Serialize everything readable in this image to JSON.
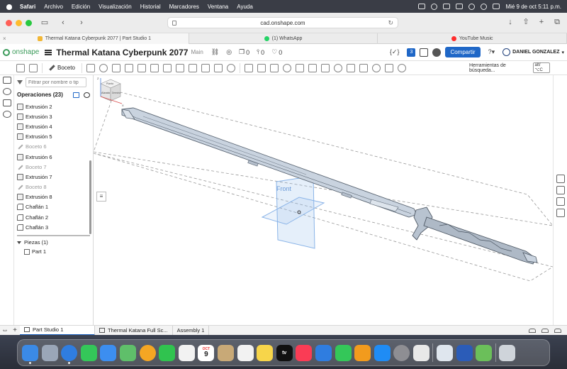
{
  "menubar": {
    "app": "Safari",
    "items": [
      "Archivo",
      "Edición",
      "Visualización",
      "Historial",
      "Marcadores",
      "Ventana",
      "Ayuda"
    ],
    "clock": "Mié 9 de oct  5:11 p.m."
  },
  "browser": {
    "url": "cad.onshape.com",
    "tabs": [
      {
        "title": "Thermal Katana Cyberpunk 2077 | Part Studio 1",
        "color": "#f2b736"
      },
      {
        "title": "(1) WhatsApp",
        "color": "#25d366"
      },
      {
        "title": "YouTube Music",
        "color": "#ff2d2d"
      }
    ]
  },
  "onshape": {
    "logo": "onshape",
    "doc_title": "Thermal Katana Cyberpunk 2077",
    "branch": "Main",
    "counters": {
      "a": "0",
      "b": "0",
      "c": "0"
    },
    "notif_count": "3",
    "share_label": "Compartir",
    "user": "DANIEL GONZALEZ",
    "brace_icon": "{✓}"
  },
  "toolbar": {
    "sketch_label": "Boceto",
    "search_placeholder": "Herramientas de búsqueda...",
    "search_shortcut": "alt/⌥C"
  },
  "features": {
    "filter_placeholder": "Filtrar por nombre o tip",
    "header": "Operaciones (23)",
    "items": [
      {
        "label": "Extrusión 2",
        "kind": "extrude"
      },
      {
        "label": "Extrusión 3",
        "kind": "extrude"
      },
      {
        "label": "Extrusión 4",
        "kind": "extrude"
      },
      {
        "label": "Extrusión 5",
        "kind": "extrude"
      },
      {
        "label": "Boceto 6",
        "kind": "sketch"
      },
      {
        "label": "Extrusión 6",
        "kind": "extrude"
      },
      {
        "label": "Boceto 7",
        "kind": "sketch"
      },
      {
        "label": "Extrusión 7",
        "kind": "extrude"
      },
      {
        "label": "Boceto 8",
        "kind": "sketch"
      },
      {
        "label": "Extrusión 8",
        "kind": "extrude"
      },
      {
        "label": "Chaflán 1",
        "kind": "chamfer"
      },
      {
        "label": "Chaflán 2",
        "kind": "chamfer"
      },
      {
        "label": "Chaflán 3",
        "kind": "chamfer"
      }
    ],
    "parts_header": "Piezas (1)",
    "parts": [
      "Part 1"
    ]
  },
  "viewport": {
    "plane_label": "Front",
    "cube": {
      "top": "Planta",
      "front": "Alzado",
      "right": "Derecha",
      "axis_z": "Z",
      "axis_x": "X"
    },
    "colors": {
      "blade": "#c9d3df",
      "blade_stroke": "#5a6572",
      "plane": "#8ab4e8"
    }
  },
  "bottom_tabs": [
    {
      "label": "Part Studio 1",
      "active": true
    },
    {
      "label": "Thermal Katana Full Sc...",
      "active": false
    },
    {
      "label": "Assembly 1",
      "active": false
    }
  ],
  "dock": {
    "calendar_month": "OCT",
    "calendar_day": "9",
    "apps": [
      {
        "name": "finder",
        "color": "#3b8ae6"
      },
      {
        "name": "launchpad",
        "color": "#9aa6b8"
      },
      {
        "name": "safari",
        "color": "#2f7de0"
      },
      {
        "name": "messages",
        "color": "#34c759"
      },
      {
        "name": "mail",
        "color": "#3c8ef0"
      },
      {
        "name": "maps",
        "color": "#5fbf6a"
      },
      {
        "name": "photos",
        "color": "#f5a623"
      },
      {
        "name": "facetime",
        "color": "#30c34f"
      },
      {
        "name": "freeform",
        "color": "#f2f2f2"
      },
      {
        "name": "calendar",
        "color": "#ffffff"
      },
      {
        "name": "contacts",
        "color": "#c8a977"
      },
      {
        "name": "reminders",
        "color": "#f2f2f2"
      },
      {
        "name": "notes",
        "color": "#f7d54a"
      },
      {
        "name": "tv",
        "color": "#111111"
      },
      {
        "name": "music",
        "color": "#fa3c55"
      },
      {
        "name": "keynote",
        "color": "#2f7de0"
      },
      {
        "name": "numbers",
        "color": "#34c759"
      },
      {
        "name": "pages",
        "color": "#f29b1d"
      },
      {
        "name": "app-store",
        "color": "#1f8cf5"
      },
      {
        "name": "system-settings",
        "color": "#8e8e93"
      },
      {
        "name": "iphone-mirroring",
        "color": "#e8e8e8"
      },
      {
        "name": "preview",
        "color": "#dfe6ee"
      },
      {
        "name": "word",
        "color": "#2b5cb8"
      },
      {
        "name": "affinity",
        "color": "#6bbf5a"
      },
      {
        "name": "trash",
        "color": "#cfd4da"
      }
    ],
    "tv_label": "tv"
  }
}
